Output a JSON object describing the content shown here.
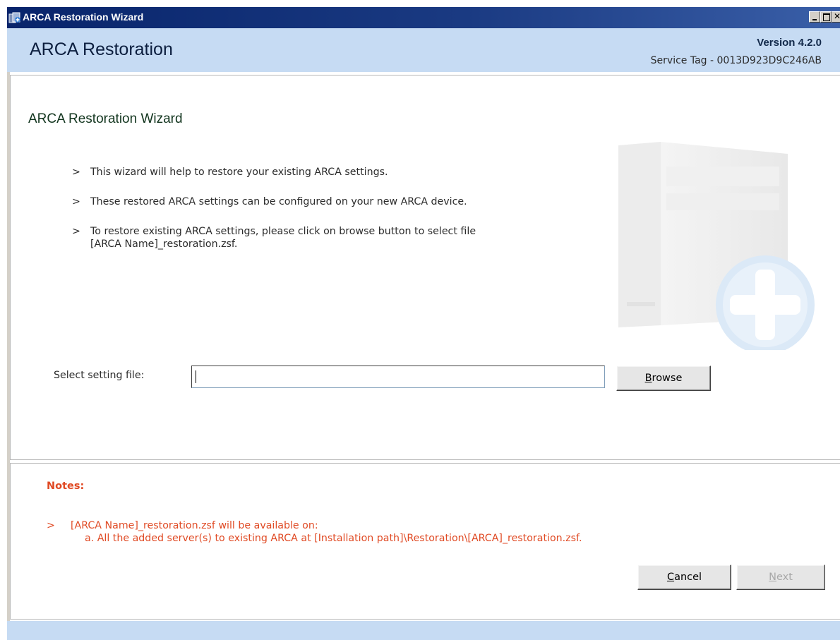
{
  "window": {
    "title": "ARCA Restoration Wizard"
  },
  "header": {
    "title": "ARCA Restoration",
    "version": "Version 4.2.0",
    "service_tag": "Service Tag - 0013D923D9C246AB"
  },
  "wizard": {
    "heading": "ARCA Restoration Wizard",
    "bullets": [
      {
        "marker": ">",
        "line1": "This wizard will help to restore your existing ARCA settings."
      },
      {
        "marker": ">",
        "line1": "These restored ARCA settings can be configured on your new ARCA device."
      },
      {
        "marker": ">",
        "line1": "To restore existing ARCA settings, please click on browse button to select file",
        "line2": "[ARCA Name]_restoration.zsf."
      }
    ],
    "select_label": "Select setting file:",
    "file_value": "",
    "browse_label_u": "B",
    "browse_label_rest": "rowse"
  },
  "notes": {
    "title": "Notes:",
    "marker": ">",
    "line1": "[ARCA Name]_restoration.zsf will be available on:",
    "line2": "a.  All the added server(s) to existing ARCA at [Installation path]\\Restoration\\[ARCA]_restoration.zsf."
  },
  "buttons": {
    "cancel_u": "C",
    "cancel_rest": "ancel",
    "next_u": "N",
    "next_rest": "ext"
  },
  "colors": {
    "titlebar": "#08246b",
    "header_bg": "#c6dbf3",
    "notes_text": "#e04a24"
  }
}
